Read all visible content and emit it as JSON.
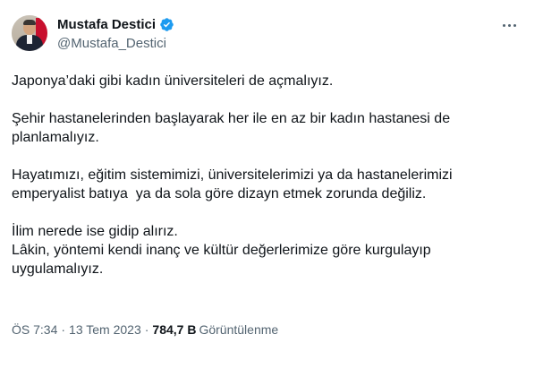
{
  "author": {
    "display_name": "Mustafa Destici",
    "handle": "@Mustafa_Destici",
    "verified_badge_color": "#1d9bf0"
  },
  "icons": {
    "verified": "verified-badge-icon",
    "more": "more-options-icon"
  },
  "tweet": {
    "paragraphs": [
      "Japonya’daki gibi kadın üniversiteleri de açmalıyız.",
      "Şehir hastanelerinden başlayarak her ile en az bir kadın hastanesi de\nplanlamalıyız.",
      "Hayatımızı, eğitim sistemimizi, üniversitelerimizi ya da hastanelerimizi\nemperyalist batıya  ya da sola göre dizayn etmek zorunda değiliz.",
      "İlim nerede ise gidip alırız.\nLâkin, yöntemi kendi inanç ve kültür değerlerimize göre kurgulayıp\nuygulamalıyız."
    ]
  },
  "meta": {
    "time": "ÖS 7:34",
    "separator": "·",
    "date": "13 Tem 2023",
    "views_count": "784,7 B",
    "views_label": "Görüntülenme"
  },
  "colors": {
    "text_primary": "#0f1419",
    "text_secondary": "#536471",
    "background": "#ffffff"
  }
}
